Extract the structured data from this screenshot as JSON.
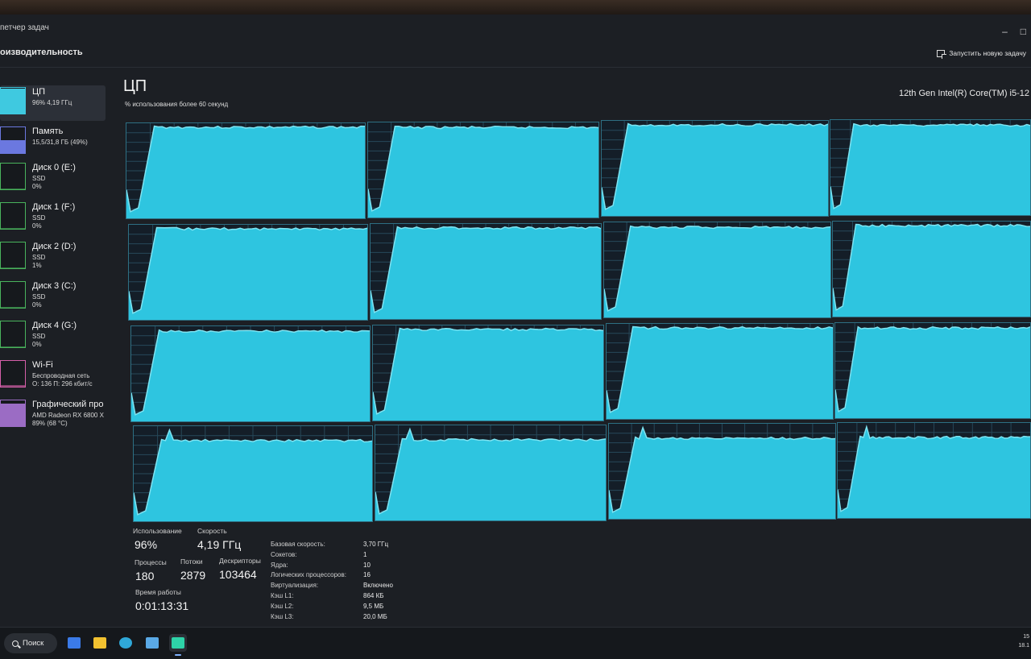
{
  "window": {
    "title": "петчер задач",
    "section": "оизводительность",
    "run_new_task": "Запустить новую задачу",
    "controls": [
      "–",
      "□"
    ]
  },
  "sidebar": {
    "items": [
      {
        "name": "ЦП",
        "line1": "96% 4,19 ГГц",
        "line2": "",
        "color": "#3fc9e0",
        "level": 0.96,
        "active": true
      },
      {
        "name": "Память",
        "line1": "15,5/31,8 ГБ (49%)",
        "line2": "",
        "color": "#6b78e0",
        "level": 0.49,
        "active": false
      },
      {
        "name": "Диск 0 (E:)",
        "line1": "SSD",
        "line2": "0%",
        "color": "#49b35c",
        "level": 0.0,
        "active": false
      },
      {
        "name": "Диск 1 (F:)",
        "line1": "SSD",
        "line2": "0%",
        "color": "#49b35c",
        "level": 0.0,
        "active": false
      },
      {
        "name": "Диск 2 (D:)",
        "line1": "SSD",
        "line2": "1%",
        "color": "#49b35c",
        "level": 0.01,
        "active": false
      },
      {
        "name": "Диск 3 (C:)",
        "line1": "SSD",
        "line2": "0%",
        "color": "#49b35c",
        "level": 0.0,
        "active": false
      },
      {
        "name": "Диск 4 (G:)",
        "line1": "SSD",
        "line2": "0%",
        "color": "#49b35c",
        "level": 0.0,
        "active": false
      },
      {
        "name": "Wi-Fi",
        "line1": "Беспроводная сеть",
        "line2": "О: 136 П: 296 кбит/с",
        "color": "#d45fa8",
        "level": 0.05,
        "active": false
      },
      {
        "name": "Графический про",
        "line1": "AMD Radeon RX 6800 X",
        "line2": "89% (68 °C)",
        "color": "#9b6cc4",
        "level": 0.89,
        "active": false
      }
    ]
  },
  "main": {
    "title": "ЦП",
    "subtitle": "% использования более 60 секунд",
    "cpu_name": "12th Gen Intel(R) Core(TM) i5-12",
    "graph_colors": {
      "fill": "#2ec5e0",
      "stroke": "#7fe4f2",
      "grid": "#27495a"
    },
    "core_levels": [
      0.97,
      0.96,
      0.97,
      0.96,
      0.97,
      0.97,
      0.96,
      0.97,
      0.96,
      0.97,
      0.97,
      0.96,
      0.86,
      0.86,
      0.86,
      0.86
    ]
  },
  "stats": {
    "usage_label": "Использование",
    "usage_value": "96%",
    "speed_label": "Скорость",
    "speed_value": "4,19 ГГц",
    "processes_label": "Процессы",
    "processes_value": "180",
    "threads_label": "Потоки",
    "threads_value": "2879",
    "handles_label": "Дескрипторы",
    "handles_value": "103464",
    "uptime_label": "Время работы",
    "uptime_value": "0:01:13:31"
  },
  "specs": [
    {
      "k": "Базовая скорость:",
      "v": "3,70 ГГц"
    },
    {
      "k": "Сокетов:",
      "v": "1"
    },
    {
      "k": "Ядра:",
      "v": "10"
    },
    {
      "k": "Логических процессоров:",
      "v": "16"
    },
    {
      "k": "Виртуализация:",
      "v": "Включено"
    },
    {
      "k": "Кэш L1:",
      "v": "864 КБ"
    },
    {
      "k": "Кэш L2:",
      "v": "9,5 МБ"
    },
    {
      "k": "Кэш L3:",
      "v": "20,0 МБ"
    }
  ],
  "taskbar": {
    "search_label": "Поиск",
    "apps": [
      {
        "name": "monitor-app-icon",
        "color": "#3b7be8"
      },
      {
        "name": "file-explorer-icon",
        "color": "#f2c230"
      },
      {
        "name": "edge-browser-icon",
        "color": "#2fa8d8"
      },
      {
        "name": "photos-app-icon",
        "color": "#5aa9e6"
      },
      {
        "name": "bf-app-icon",
        "color": "#2ed3a8",
        "active": true
      }
    ],
    "clock_time": "15",
    "clock_date": "18.1"
  }
}
